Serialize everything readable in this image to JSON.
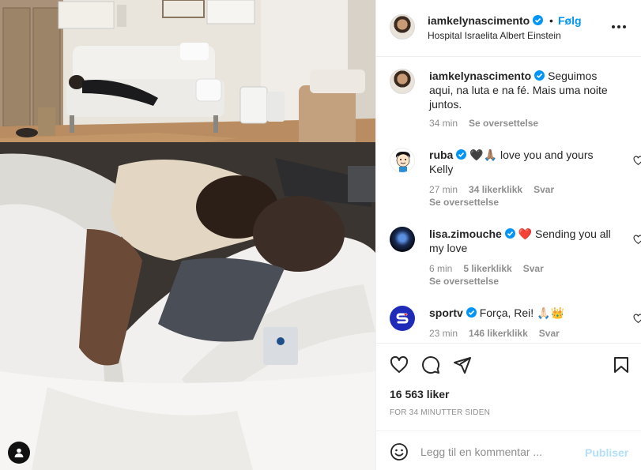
{
  "post": {
    "username": "iamkelynascimento",
    "follow_label": "Følg",
    "separator": "•",
    "location": "Hospital Israelita Albert Einstein"
  },
  "caption": {
    "username": "iamkelynascimento",
    "text": "Seguimos aqui, na luta e na fé. Mais uma noite juntos.",
    "time": "34 min",
    "translate": "Se oversettelse"
  },
  "comments": [
    {
      "username": "ruba",
      "text": "🖤🙏🏽 love you and yours Kelly",
      "time": "27 min",
      "likes": "34 likerklikk",
      "reply": "Svar",
      "translate": "Se oversettelse"
    },
    {
      "username": "lisa.zimouche",
      "text": "❤️ Sending you all my love",
      "time": "6 min",
      "likes": "5 likerklikk",
      "reply": "Svar",
      "translate": "Se oversettelse"
    },
    {
      "username": "sportv",
      "text": "Força, Rei! 🙏🏻👑",
      "time": "23 min",
      "likes": "146 likerklikk",
      "reply": "Svar"
    }
  ],
  "stats": {
    "likes": "16 563 liker",
    "timestamp": "FOR 34 MINUTTER SIDEN"
  },
  "composer": {
    "placeholder": "Legg til en kommentar ...",
    "publish_label": "Publiser"
  },
  "icons": {
    "header": [
      "verified-badge-icon",
      "more-options-icon"
    ],
    "actions": [
      "heart-icon",
      "comment-icon",
      "share-icon",
      "bookmark-icon"
    ],
    "composer": [
      "emoji-icon"
    ]
  },
  "colors": {
    "accent": "#0095f6",
    "publish_disabled": "#b2dffc",
    "verified": "#0095f6",
    "muted": "#8e8e8e"
  }
}
